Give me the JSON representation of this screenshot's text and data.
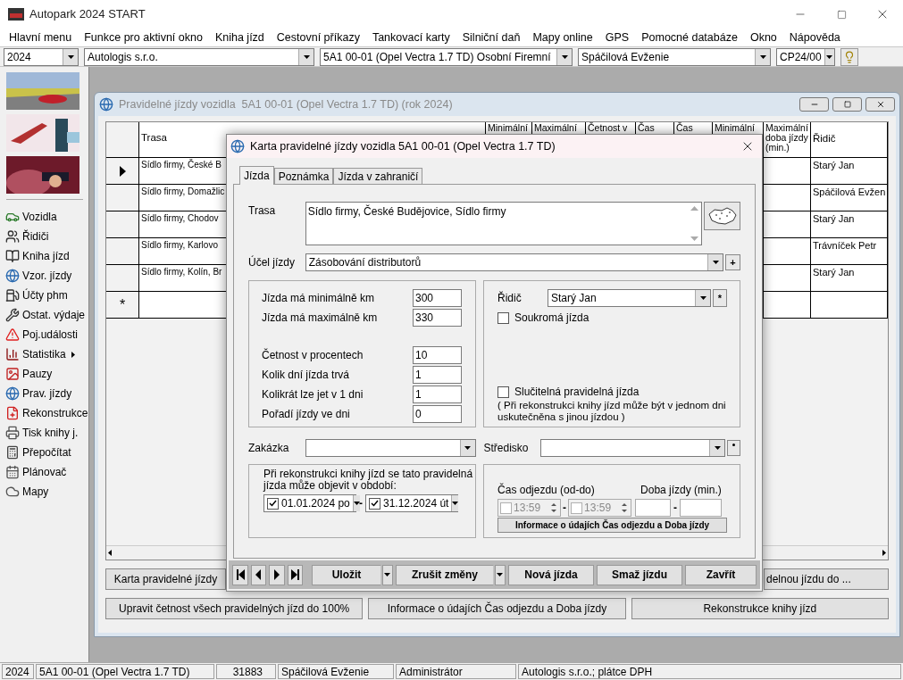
{
  "window": {
    "title": "Autopark 2024 START"
  },
  "menu": [
    "Hlavní menu",
    "Funkce pro aktivní okno",
    "Kniha jízd",
    "Cestovní příkazy",
    "Tankovací karty",
    "Silniční daň",
    "Mapy online",
    "GPS",
    "Pomocné databáze",
    "Okno",
    "Nápověda"
  ],
  "toolbar": {
    "combos": [
      {
        "value": "2024"
      },
      {
        "value": "Autologis s.r.o."
      },
      {
        "value": "5A1 00-01 (Opel Vectra 1.7 TD) Osobní Firemní"
      },
      {
        "value": "Spáčilová Evženie"
      },
      {
        "value": "CP24/00"
      }
    ]
  },
  "sidebar": {
    "items": [
      {
        "label": "Vozidla",
        "submenu": false
      },
      {
        "label": "Řidiči",
        "submenu": false
      },
      {
        "label": "Kniha jízd",
        "submenu": false
      },
      {
        "label": "Vzor. jízdy",
        "submenu": false
      },
      {
        "label": "Účty phm",
        "submenu": false
      },
      {
        "label": "Ostat. výdaje",
        "submenu": false
      },
      {
        "label": "Poj.události",
        "submenu": false
      },
      {
        "label": "Statistika",
        "submenu": true
      },
      {
        "label": "Pauzy",
        "submenu": false
      },
      {
        "label": "Prav. jízdy",
        "submenu": false
      },
      {
        "label": "Rekonstrukce",
        "submenu": false
      },
      {
        "label": "Tisk knihy j.",
        "submenu": false
      },
      {
        "label": "Přepočítat",
        "submenu": false
      },
      {
        "label": "Plánovač",
        "submenu": false
      },
      {
        "label": "Mapy",
        "submenu": false
      }
    ]
  },
  "child_window": {
    "title": "Pravidelné jízdy vozidla  5A1 00-01 (Opel Vectra 1.7 TD) (rok 2024)",
    "table": {
      "columns": [
        "Trasa",
        "Minimální",
        "Maximální",
        "Četnost v",
        "Čas",
        "Čas",
        "Minimální",
        "Maximální doba jízdy (min.)",
        "Řidič"
      ],
      "rows": [
        {
          "selected": true,
          "trasa": "Sídlo firmy, České B",
          "ridic": "Starý Jan"
        },
        {
          "selected": false,
          "trasa": "Sídlo firmy, Domažlic",
          "ridic": "Spáčilová Evžen"
        },
        {
          "selected": false,
          "trasa": "Sídlo firmy, Chodov",
          "ridic": "Starý Jan"
        },
        {
          "selected": false,
          "trasa": "Sídlo firmy, Karlovo",
          "ridic": "Trávníček Petr"
        },
        {
          "selected": false,
          "trasa": "Sídlo firmy, Kolín, Br",
          "ridic": "Starý Jan"
        }
      ],
      "new_row_marker": "*"
    },
    "buttons": [
      [
        "Karta pravidelné jízdy",
        "delnou jízdu do ..."
      ],
      [
        "Upravit četnost všech pravidelných jízd do 100%",
        "Informace o údajích Čas odjezdu a Doba jízdy",
        "Rekonstrukce knihy jízd"
      ]
    ]
  },
  "dialog": {
    "title": "Karta pravidelné jízdy vozidla 5A1 00-01 (Opel Vectra 1.7 TD)",
    "tabs": [
      {
        "label": "Jízda",
        "selected": true
      },
      {
        "label": "Poznámka",
        "selected": false
      },
      {
        "label": "Jízda v zahraničí",
        "selected": false
      }
    ],
    "trasa": {
      "label": "Trasa",
      "value": "Sídlo firmy, České Budějovice, Sídlo firmy"
    },
    "ucel": {
      "label": "Účel jízdy",
      "value": "Zásobování distributorů",
      "add_label": "+"
    },
    "km_fields": [
      {
        "label": "Jízda má minimálně km",
        "value": "300"
      },
      {
        "label": "Jízda má maximálně km",
        "value": "330"
      }
    ],
    "other_fields": [
      {
        "label": "Četnost v procentech",
        "value": "10"
      },
      {
        "label": "Kolik dní jízda trvá",
        "value": "1"
      },
      {
        "label": "Kolikrát lze jet v 1 dni",
        "value": "1"
      },
      {
        "label": "Pořadí jízdy ve dni",
        "value": "0"
      }
    ],
    "ridic": {
      "label": "Řidič",
      "value": "Starý Jan",
      "add_label": "*"
    },
    "private": {
      "label": "Soukromá jízda",
      "checked": false
    },
    "combinable": {
      "label": "Slučitelná pravidelná jízda",
      "checked": false
    },
    "combinable_note": "( Při rekonstrukci knihy jízd může být v jednom dni uskutečněna s jinou jízdou )",
    "zakazka": {
      "label": "Zakázka"
    },
    "stredisko": {
      "label": "Středisko"
    },
    "period": {
      "text": "Při rekonstrukci knihy jízd se tato pravidelná jízda může objevit v období:",
      "separator": "-",
      "from": {
        "checked": true,
        "value": "01.01.2024 po"
      },
      "to": {
        "checked": true,
        "value": "31.12.2024 út"
      }
    },
    "time": {
      "label": "Čas odjezdu (od-do)",
      "separator": "-",
      "duration_separator": "-",
      "duration_label": "Doba jízdy (min.)",
      "from": {
        "checked": false,
        "disabled": true,
        "value": "13:59"
      },
      "to": {
        "checked": false,
        "disabled": true,
        "value": "13:59"
      },
      "info_button": "Informace o údajích Čas odjezdu a Doba jízdy"
    },
    "buttons": [
      {
        "label": "Uložit",
        "dropdown": true
      },
      {
        "label": "Zrušit změny",
        "dropdown": true
      },
      {
        "label": "Nová jízda",
        "dropdown": false
      },
      {
        "label": "Smaž jízdu",
        "dropdown": false
      },
      {
        "label": "Zavřít",
        "dropdown": false
      }
    ]
  },
  "status_bar": [
    "2024",
    "5A1 00-01 (Opel Vectra 1.7 TD)",
    "31883",
    "Spáčilová Evženie",
    "Administrátor",
    "Autologis s.r.o.;  plátce DPH"
  ]
}
